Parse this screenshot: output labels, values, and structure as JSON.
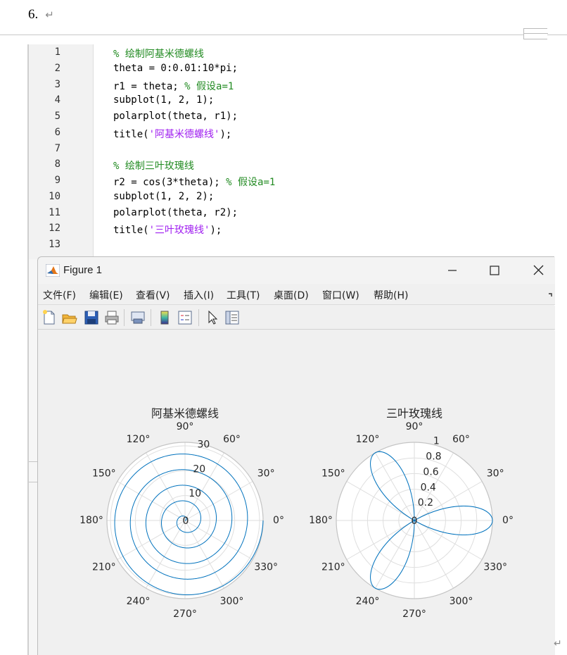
{
  "document": {
    "heading": "6.",
    "return_mark": "↵"
  },
  "editor": {
    "lines": [
      {
        "num": "1",
        "segments": [
          {
            "t": "% 绘制阿基米德螺线",
            "c": "cmt"
          }
        ]
      },
      {
        "num": "2",
        "segments": [
          {
            "t": "theta = 0:0.01:10*pi;",
            "c": ""
          }
        ]
      },
      {
        "num": "3",
        "segments": [
          {
            "t": "r1 = theta; ",
            "c": ""
          },
          {
            "t": "% 假设a=1",
            "c": "cmt"
          }
        ]
      },
      {
        "num": "4",
        "segments": [
          {
            "t": "subplot(1, 2, 1);",
            "c": ""
          }
        ]
      },
      {
        "num": "5",
        "segments": [
          {
            "t": "polarplot(theta, r1);",
            "c": ""
          }
        ]
      },
      {
        "num": "6",
        "segments": [
          {
            "t": "title(",
            "c": ""
          },
          {
            "t": "'阿基米德螺线'",
            "c": "str"
          },
          {
            "t": ");",
            "c": ""
          }
        ]
      },
      {
        "num": "7",
        "segments": []
      },
      {
        "num": "8",
        "segments": [
          {
            "t": "% 绘制三叶玫瑰线",
            "c": "cmt"
          }
        ]
      },
      {
        "num": "9",
        "segments": [
          {
            "t": "r2 = cos(3*theta); ",
            "c": ""
          },
          {
            "t": "% 假设a=1",
            "c": "cmt"
          }
        ]
      },
      {
        "num": "10",
        "segments": [
          {
            "t": "subplot(1, 2, 2);",
            "c": ""
          }
        ]
      },
      {
        "num": "11",
        "segments": [
          {
            "t": "polarplot(theta, r2);",
            "c": ""
          }
        ]
      },
      {
        "num": "12",
        "segments": [
          {
            "t": "title(",
            "c": ""
          },
          {
            "t": "'三叶玫瑰线'",
            "c": "str"
          },
          {
            "t": ");",
            "c": ""
          }
        ]
      },
      {
        "num": "13",
        "segments": []
      }
    ]
  },
  "figure_window": {
    "title": "Figure 1",
    "menus": [
      "文件(F)",
      "编辑(E)",
      "查看(V)",
      "插入(I)",
      "工具(T)",
      "桌面(D)",
      "窗口(W)",
      "帮助(H)"
    ],
    "toolbar_icons": [
      "new-figure-icon",
      "open-folder-icon",
      "save-icon",
      "print-icon",
      "link-plot-icon",
      "colorbar-icon",
      "legend-icon",
      "pointer-icon",
      "property-inspector-icon"
    ]
  },
  "chart_data": [
    {
      "type": "line",
      "polar": true,
      "title": "阿基米德螺线",
      "equation": "r = theta",
      "theta_range": [
        0,
        31.416
      ],
      "r_ticks": [
        "0",
        "10",
        "20",
        "30"
      ],
      "rlim": [
        0,
        31.416
      ],
      "theta_ticks": [
        "0°",
        "30°",
        "60°",
        "90°",
        "120°",
        "150°",
        "180°",
        "210°",
        "240°",
        "270°",
        "300°",
        "330°"
      ],
      "grid": true,
      "line_color": "#0072bd"
    },
    {
      "type": "line",
      "polar": true,
      "title": "三叶玫瑰线",
      "equation": "r = cos(3*theta)",
      "theta_range": [
        0,
        31.416
      ],
      "r_ticks": [
        "0",
        "0.2",
        "0.4",
        "0.6",
        "0.8",
        "1"
      ],
      "rlim": [
        0,
        1
      ],
      "theta_ticks": [
        "0°",
        "30°",
        "60°",
        "90°",
        "120°",
        "150°",
        "180°",
        "210°",
        "240°",
        "270°",
        "300°",
        "330°"
      ],
      "grid": true,
      "line_color": "#0072bd"
    }
  ]
}
